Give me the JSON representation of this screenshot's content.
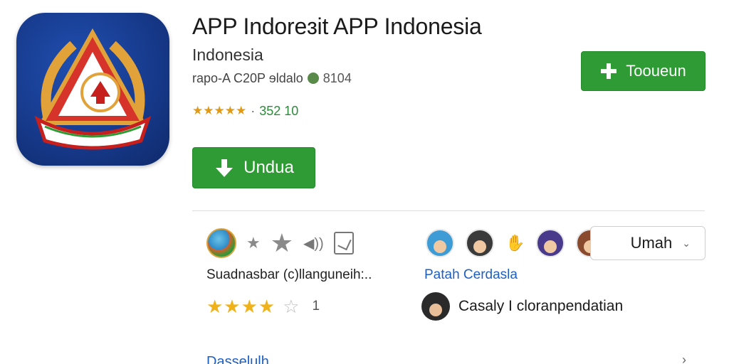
{
  "app": {
    "title": "APP Indoreɜit APP Indonesia",
    "subtitle": "Indonesia",
    "meta_text": "rapo-A C20P ɘldalo",
    "meta_count": "8104",
    "rating_stars": "★★★★★",
    "rating_sep": "·",
    "rating_count": "352 10"
  },
  "buttons": {
    "download_label": "Undua",
    "install_label": "Tooueun"
  },
  "review": {
    "text": "Suadnasbar (c)llanguneih:..",
    "stars_filled": "★★★★",
    "star_empty": "☆",
    "count": "1"
  },
  "developer": {
    "link": "Patah Cerdasla",
    "user_name": "Casaly I cloranpendatian"
  },
  "dropdown": {
    "selected": "Umah"
  },
  "bottom": {
    "link": "Dasselulh",
    "chevron": "›"
  },
  "colors": {
    "primary_green": "#2e9b35",
    "link_blue": "#1f5fbf",
    "star_gold": "#f0b21b",
    "icon_blue": "#173a8c"
  }
}
